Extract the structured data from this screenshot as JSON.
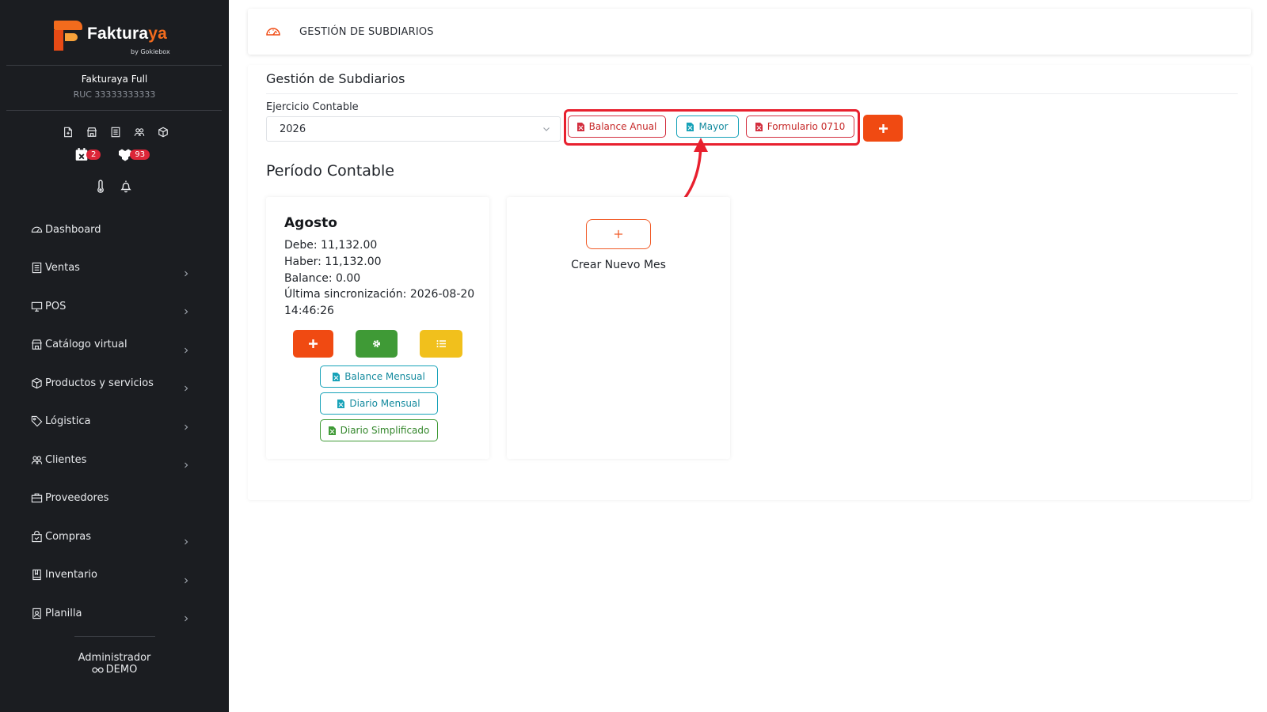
{
  "sidebar": {
    "brand": {
      "name_main": "Faktura",
      "name_accent": "ya",
      "byline": "by Gokiebox"
    },
    "company_name": "Fakturaya Full",
    "company_ruc": "RUC 33333333333",
    "quick_icons": [
      "file-plus-icon",
      "store-icon",
      "receipt-icon",
      "users-icon",
      "box-icon"
    ],
    "badges": [
      {
        "icon": "calendar-x-icon",
        "count": "2"
      },
      {
        "icon": "boxes-icon",
        "count": "93"
      }
    ],
    "menu": [
      {
        "label": "Dashboard",
        "icon": "gauge-icon",
        "has_children": false
      },
      {
        "label": "Ventas",
        "icon": "receipt-icon",
        "has_children": true
      },
      {
        "label": "POS",
        "icon": "monitor-icon",
        "has_children": true
      },
      {
        "label": "Catálogo virtual",
        "icon": "store-icon",
        "has_children": true
      },
      {
        "label": "Productos y servicios",
        "icon": "box-icon",
        "has_children": true
      },
      {
        "label": "Lógistica",
        "icon": "tag-icon",
        "has_children": true
      },
      {
        "label": "Clientes",
        "icon": "users-icon",
        "has_children": true
      },
      {
        "label": "Proveedores",
        "icon": "briefcase-icon",
        "has_children": false
      },
      {
        "label": "Compras",
        "icon": "bag-icon",
        "has_children": true
      },
      {
        "label": "Inventario",
        "icon": "book-icon",
        "has_children": true
      },
      {
        "label": "Planilla",
        "icon": "id-badge-icon",
        "has_children": true
      }
    ],
    "user_role": "Administrador",
    "user_name": "DEMO"
  },
  "topbar": {
    "title": "GESTIÓN DE SUBDIARIOS",
    "icon": "gauge-icon"
  },
  "main": {
    "heading": "Gestión de Subdiarios",
    "ejercicio_label": "Ejercicio Contable",
    "ejercicio_value": "2026",
    "report_buttons": {
      "balance_anual": "Balance Anual",
      "mayor": "Mayor",
      "formulario": "Formulario 0710"
    },
    "add_button_icon": "plus-icon",
    "period_title": "Período Contable",
    "month": {
      "name": "Agosto",
      "debe": "Debe: 11,132.00",
      "haber": "Haber: 11,132.00",
      "balance": "Balance: 0.00",
      "sync_line1": "Última sincronización: 2026-08-20",
      "sync_line2": "14:46:26",
      "buttons": {
        "balance_mensual": "Balance Mensual",
        "diario_mensual": "Diario Mensual",
        "diario_simplificado": "Diario Simplificado"
      }
    },
    "new_month": {
      "label": "Crear Nuevo Mes",
      "icon": "plus-icon"
    }
  },
  "colors": {
    "sidebar_bg": "#1b1d21",
    "brand_orange": "#f26b1d",
    "accent_red": "#f04a12",
    "badge_red": "#dc2638",
    "teal": "#17a2b8",
    "green": "#3f9a36",
    "yellow": "#f1c01c",
    "highlight_red": "#e8202e"
  }
}
